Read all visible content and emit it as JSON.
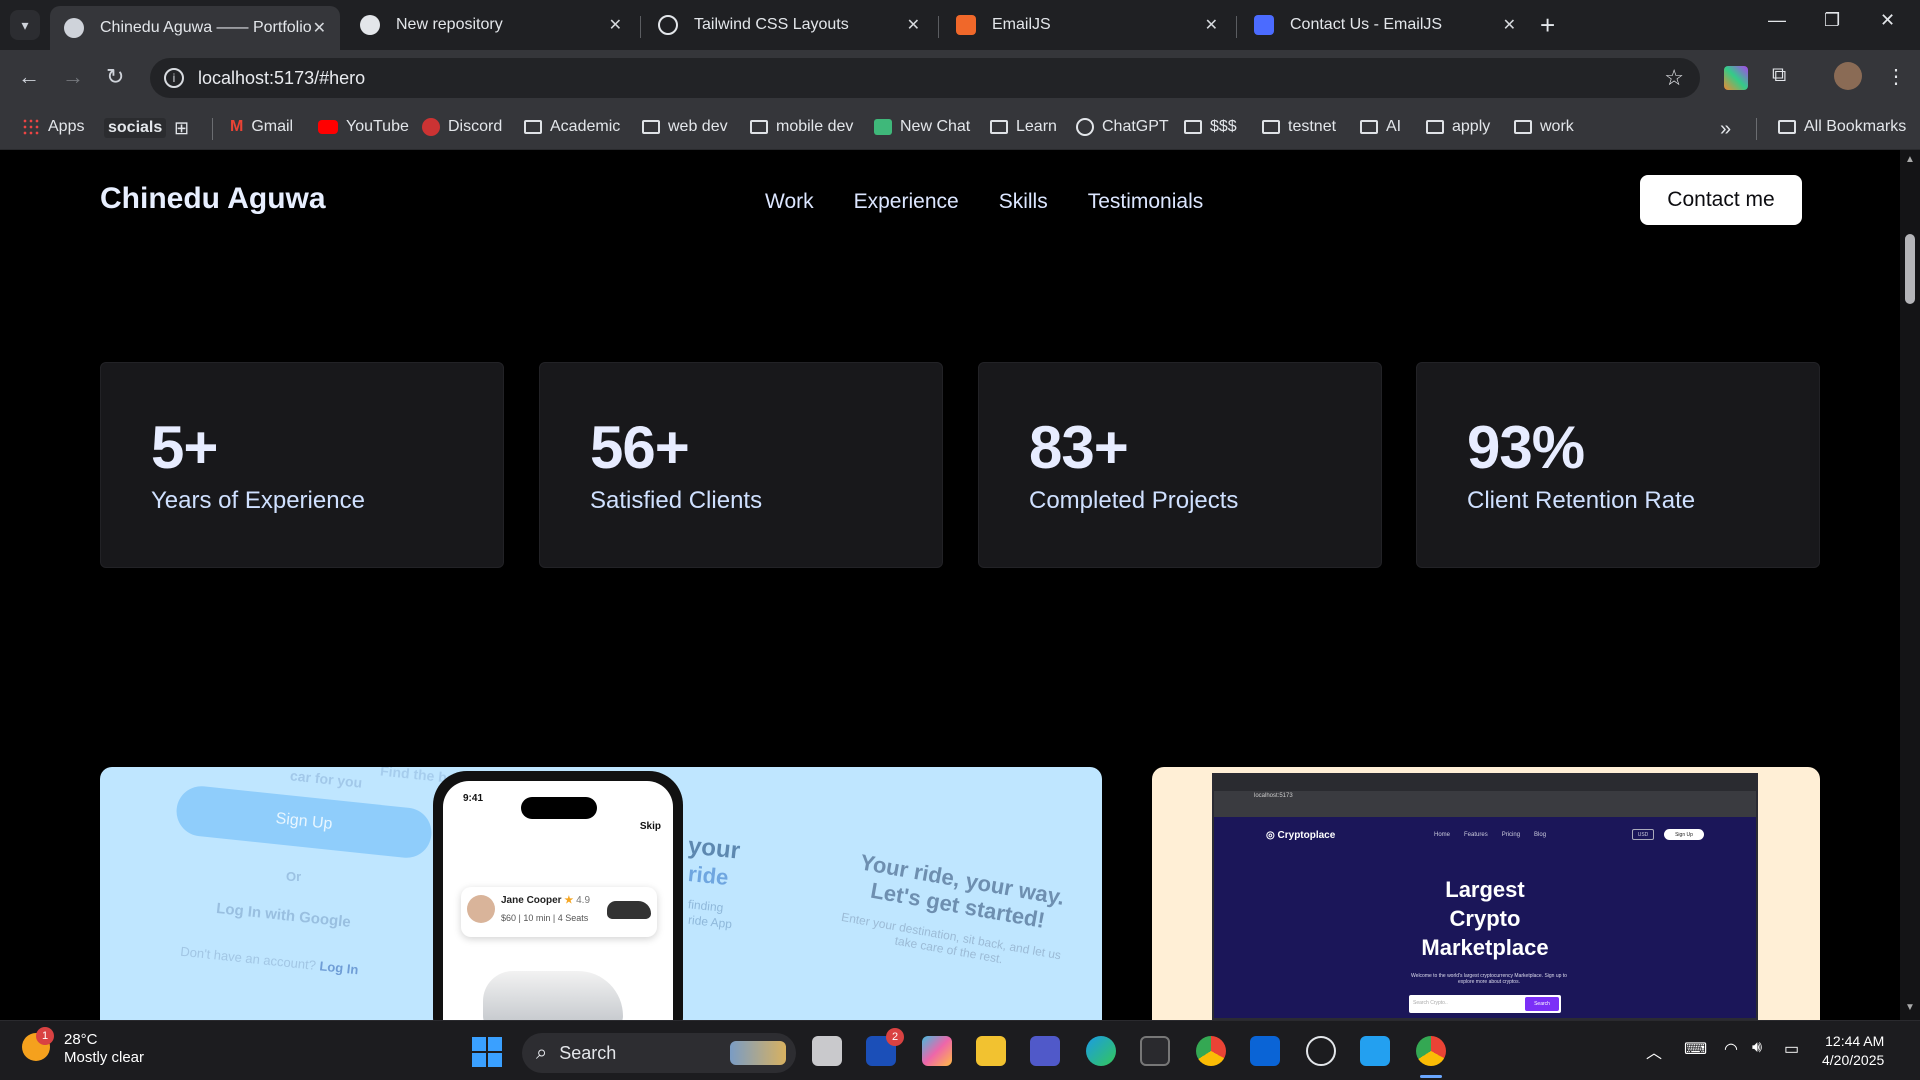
{
  "browser": {
    "tabs": [
      {
        "title": "Chinedu Aguwa —— Portfolio",
        "active": true,
        "favicon": "globe-icon"
      },
      {
        "title": "New repository",
        "active": false,
        "favicon": "github-icon"
      },
      {
        "title": "Tailwind CSS Layouts",
        "active": false,
        "favicon": "chatgpt-icon"
      },
      {
        "title": "EmailJS",
        "active": false,
        "favicon": "emailjs-icon"
      },
      {
        "title": "Contact Us - EmailJS",
        "active": false,
        "favicon": "emailjs-icon"
      }
    ],
    "url": "localhost:5173/#hero",
    "bookmarks": [
      {
        "label": "Apps",
        "icon": "apps-grid-icon"
      },
      {
        "label": "socials",
        "icon": ""
      },
      {
        "label": "",
        "icon": "grid-icon"
      },
      {
        "label": "Gmail",
        "icon": "gmail-icon"
      },
      {
        "label": "YouTube",
        "icon": "youtube-icon"
      },
      {
        "label": "Discord",
        "icon": "discord-icon"
      },
      {
        "label": "Academic",
        "icon": "folder-icon"
      },
      {
        "label": "web dev",
        "icon": "folder-icon"
      },
      {
        "label": "mobile dev",
        "icon": "folder-icon"
      },
      {
        "label": "New Chat",
        "icon": "chat-bot-icon"
      },
      {
        "label": "Learn",
        "icon": "folder-icon"
      },
      {
        "label": "ChatGPT",
        "icon": "chatgpt-icon"
      },
      {
        "label": "$$$",
        "icon": "folder-icon"
      },
      {
        "label": "testnet",
        "icon": "folder-icon"
      },
      {
        "label": "AI",
        "icon": "folder-icon"
      },
      {
        "label": "apply",
        "icon": "folder-icon"
      },
      {
        "label": "work",
        "icon": "folder-icon"
      }
    ],
    "all_bookmarks": "All Bookmarks",
    "more_bookmarks": "»"
  },
  "site": {
    "brand": "Chinedu Aguwa",
    "nav": [
      "Work",
      "Experience",
      "Skills",
      "Testimonials"
    ],
    "contact_button": "Contact me",
    "stats": [
      {
        "value": "5+",
        "label": "Years of Experience"
      },
      {
        "value": "56+",
        "label": "Satisfied Clients"
      },
      {
        "value": "83+",
        "label": "Completed Projects"
      },
      {
        "value": "93%",
        "label": "Client Retention Rate"
      }
    ],
    "projects": {
      "ride_app": {
        "ghost_texts": {
          "car_for_you": "car for you",
          "find_best": "Find the best",
          "sign_up": "Sign Up",
          "or": "Or",
          "log_in_google": "Log In with Google",
          "dont_have_account": "Don't have an account?",
          "log_in": "Log In",
          "your": "your",
          "ride": "ride",
          "finding": "finding",
          "ride_app": "ride App",
          "headline": "Your ride, your way. Let's get started!",
          "subline": "Enter your destination, sit back, and let us take care of the rest."
        },
        "phone_time": "9:41",
        "skip": "Skip",
        "driver_name": "Jane Cooper",
        "driver_rating": "4.9",
        "price": "$60",
        "duration": "10 min",
        "seats": "4 Seats"
      },
      "crypto": {
        "logo": "Cryptoplace",
        "nav": [
          "Home",
          "Features",
          "Pricing",
          "Blog"
        ],
        "currency": "USD",
        "signup": "Sign Up",
        "title_lines": [
          "Largest",
          "Crypto",
          "Marketplace"
        ],
        "subtitle": "Welcome to the world's largest cryptocurrency Marketplace. Sign up to explore more about cryptos.",
        "search_placeholder": "Search Crypto..",
        "search_button": "Search",
        "url": "localhost:5173"
      }
    }
  },
  "taskbar": {
    "weather_temp": "28°C",
    "weather_desc": "Mostly clear",
    "weather_badge": "1",
    "search_label": "Search",
    "time": "12:44 AM",
    "date": "4/20/2025",
    "notification_badge": "2"
  },
  "colors": {
    "accent_white": "#ffffff",
    "card_bg": "#18181b",
    "ride_bg": "#bfe6ff",
    "crypto_bg": "#ffefd6",
    "crypto_dark": "#1b1659"
  }
}
